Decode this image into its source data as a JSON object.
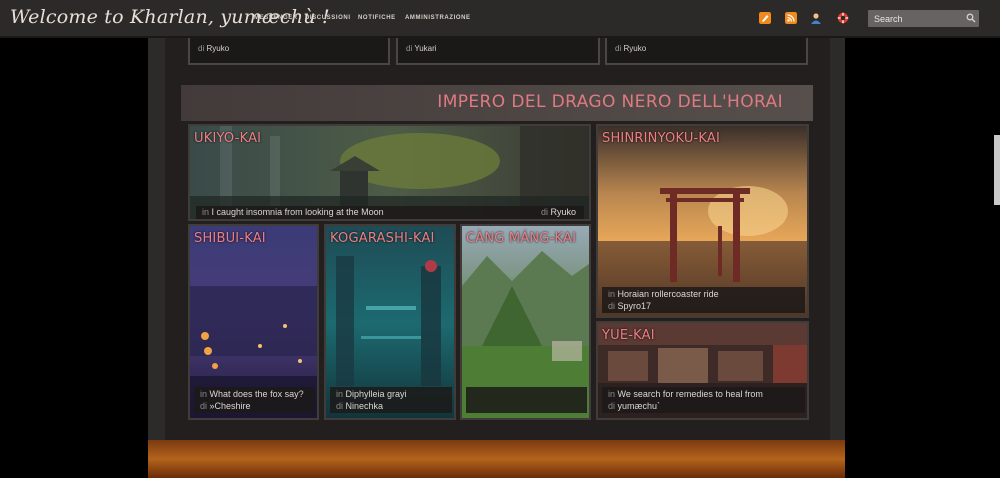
{
  "header": {
    "brand": "Welcome to Kharlan, yumæchù !",
    "nav": [
      "MESSENGER",
      "DISCUSSIONI",
      "NOTIFICHE",
      "AMMINISTRAZIONE"
    ],
    "search_placeholder": "Search",
    "icons": [
      "notepad-icon",
      "rss-icon",
      "user-icon",
      "lifebuoy-icon",
      "search-icon"
    ]
  },
  "top_cards": [
    {
      "prefix": "di",
      "author": "Ryuko"
    },
    {
      "prefix": "di",
      "author": "Yukari"
    },
    {
      "prefix": "di",
      "author": "Ryuko"
    }
  ],
  "category": {
    "title": "IMPERO DEL DRAGO NERO DELL'HORAI"
  },
  "forums": {
    "ukiyo": {
      "title": "UKIYO-KAI",
      "in_prefix": "in",
      "last_post": "I caught insomnia from looking at the Moon",
      "by_prefix": "di",
      "author": "Ryuko"
    },
    "shinrinyoku": {
      "title": "SHINRINYOKU-KAI",
      "in_prefix": "in",
      "last_post": "Horaian rollercoaster ride",
      "by_prefix": "di",
      "author": "Spyro17"
    },
    "shibui": {
      "title": "SHIBUI-KAI",
      "in_prefix": "in",
      "last_post": "What does the fox say?",
      "by_prefix": "di",
      "author": "»Cheshire"
    },
    "kogarashi": {
      "title": "KOGARASHI-KAI",
      "in_prefix": "in",
      "last_post": "Diphylleia grayi",
      "by_prefix": "di",
      "author": "Ninechka"
    },
    "cangmang": {
      "title": "CÀNG MÁNG-KAI"
    },
    "yue": {
      "title": "YUE-KAI",
      "in_prefix": "in",
      "last_post": "We search for remedies to heal from",
      "by_prefix": "di",
      "author": "yumæchu`"
    }
  },
  "colors": {
    "accent_title": "#ec7f86",
    "topbar": "#2c2a28",
    "panel": "#221f1e"
  }
}
